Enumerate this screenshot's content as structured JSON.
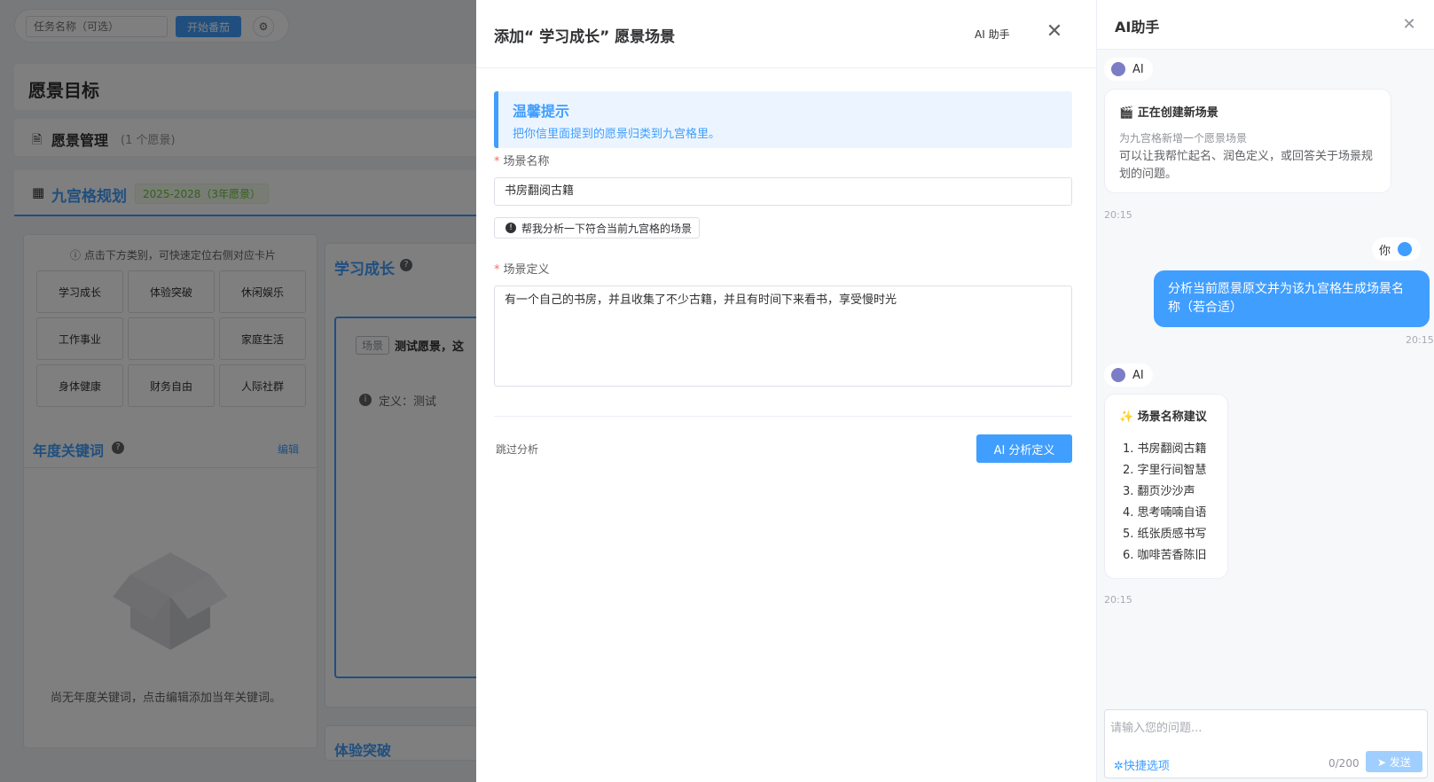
{
  "topbar": {
    "task_placeholder": "任务名称（可选）",
    "start_label": "开始番茄",
    "settings_icon": "gear-icon"
  },
  "page": {
    "title": "愿景目标",
    "management": {
      "title": "愿景管理",
      "count": "(1 个愿景)"
    },
    "grid_tab": {
      "title": "九宫格规划",
      "years": "2025-2028（3年愿景）"
    }
  },
  "left_panel": {
    "hint": "点击下方类别，可快速定位右侧对应卡片",
    "categories": [
      "学习成长",
      "体验突破",
      "休闲娱乐",
      "工作事业",
      "",
      "家庭生活",
      "身体健康",
      "财务自由",
      "人际社群"
    ],
    "year_keywords": {
      "title": "年度关键词",
      "edit": "编辑",
      "empty": "尚无年度关键词，点击编辑添加当年关键词。"
    }
  },
  "study_panel": {
    "title": "学习成长",
    "scene_tag": "场景",
    "scene_name": "测试愿景，这",
    "scene_def": "定义：测试",
    "next_title": "体验突破"
  },
  "dialog": {
    "title": "添加“ 学习成长” 愿景场景",
    "ai_help": "AI 助手",
    "tip_title": "温馨提示",
    "tip_text": "把你信里面提到的愿景归类到九宫格里。",
    "name_label": "场景名称",
    "name_value": "书房翻阅古籍",
    "analyze_btn": "帮我分析一下符合当前九宫格的场景",
    "def_label": "场景定义",
    "def_value": "有一个自己的书房，并且收集了不少古籍，并且有时间下来看书，享受慢时光",
    "skip": "跳过分析",
    "ai_analyze": "AI 分析定义"
  },
  "ai_panel": {
    "title": "AI助手",
    "ai_name": "AI",
    "user_name": "你",
    "msg1": {
      "title": "正在创建新场景",
      "sub": "为九宫格新增一个愿景场景",
      "text": "可以让我帮忙起名、润色定义，或回答关于场景规划的问题。",
      "time": "20:15"
    },
    "user_msg": {
      "text": "分析当前愿景原文并为该九宫格生成场景名称（若合适）",
      "time": "20:15"
    },
    "msg2": {
      "title": "场景名称建议",
      "items": [
        "1. 书房翻阅古籍",
        "2. 字里行间智慧",
        "3. 翻页沙沙声",
        "4. 思考喃喃自语",
        "5. 纸张质感书写",
        "6. 咖啡苦香陈旧"
      ],
      "time": "20:15"
    },
    "input": {
      "placeholder": "请输入您的问题...",
      "quick": "快捷选项",
      "counter": "0/200",
      "send": "发送"
    }
  },
  "colors": {
    "accent": "#409eff",
    "danger": "#f56c6c",
    "success": "#67c23a"
  }
}
